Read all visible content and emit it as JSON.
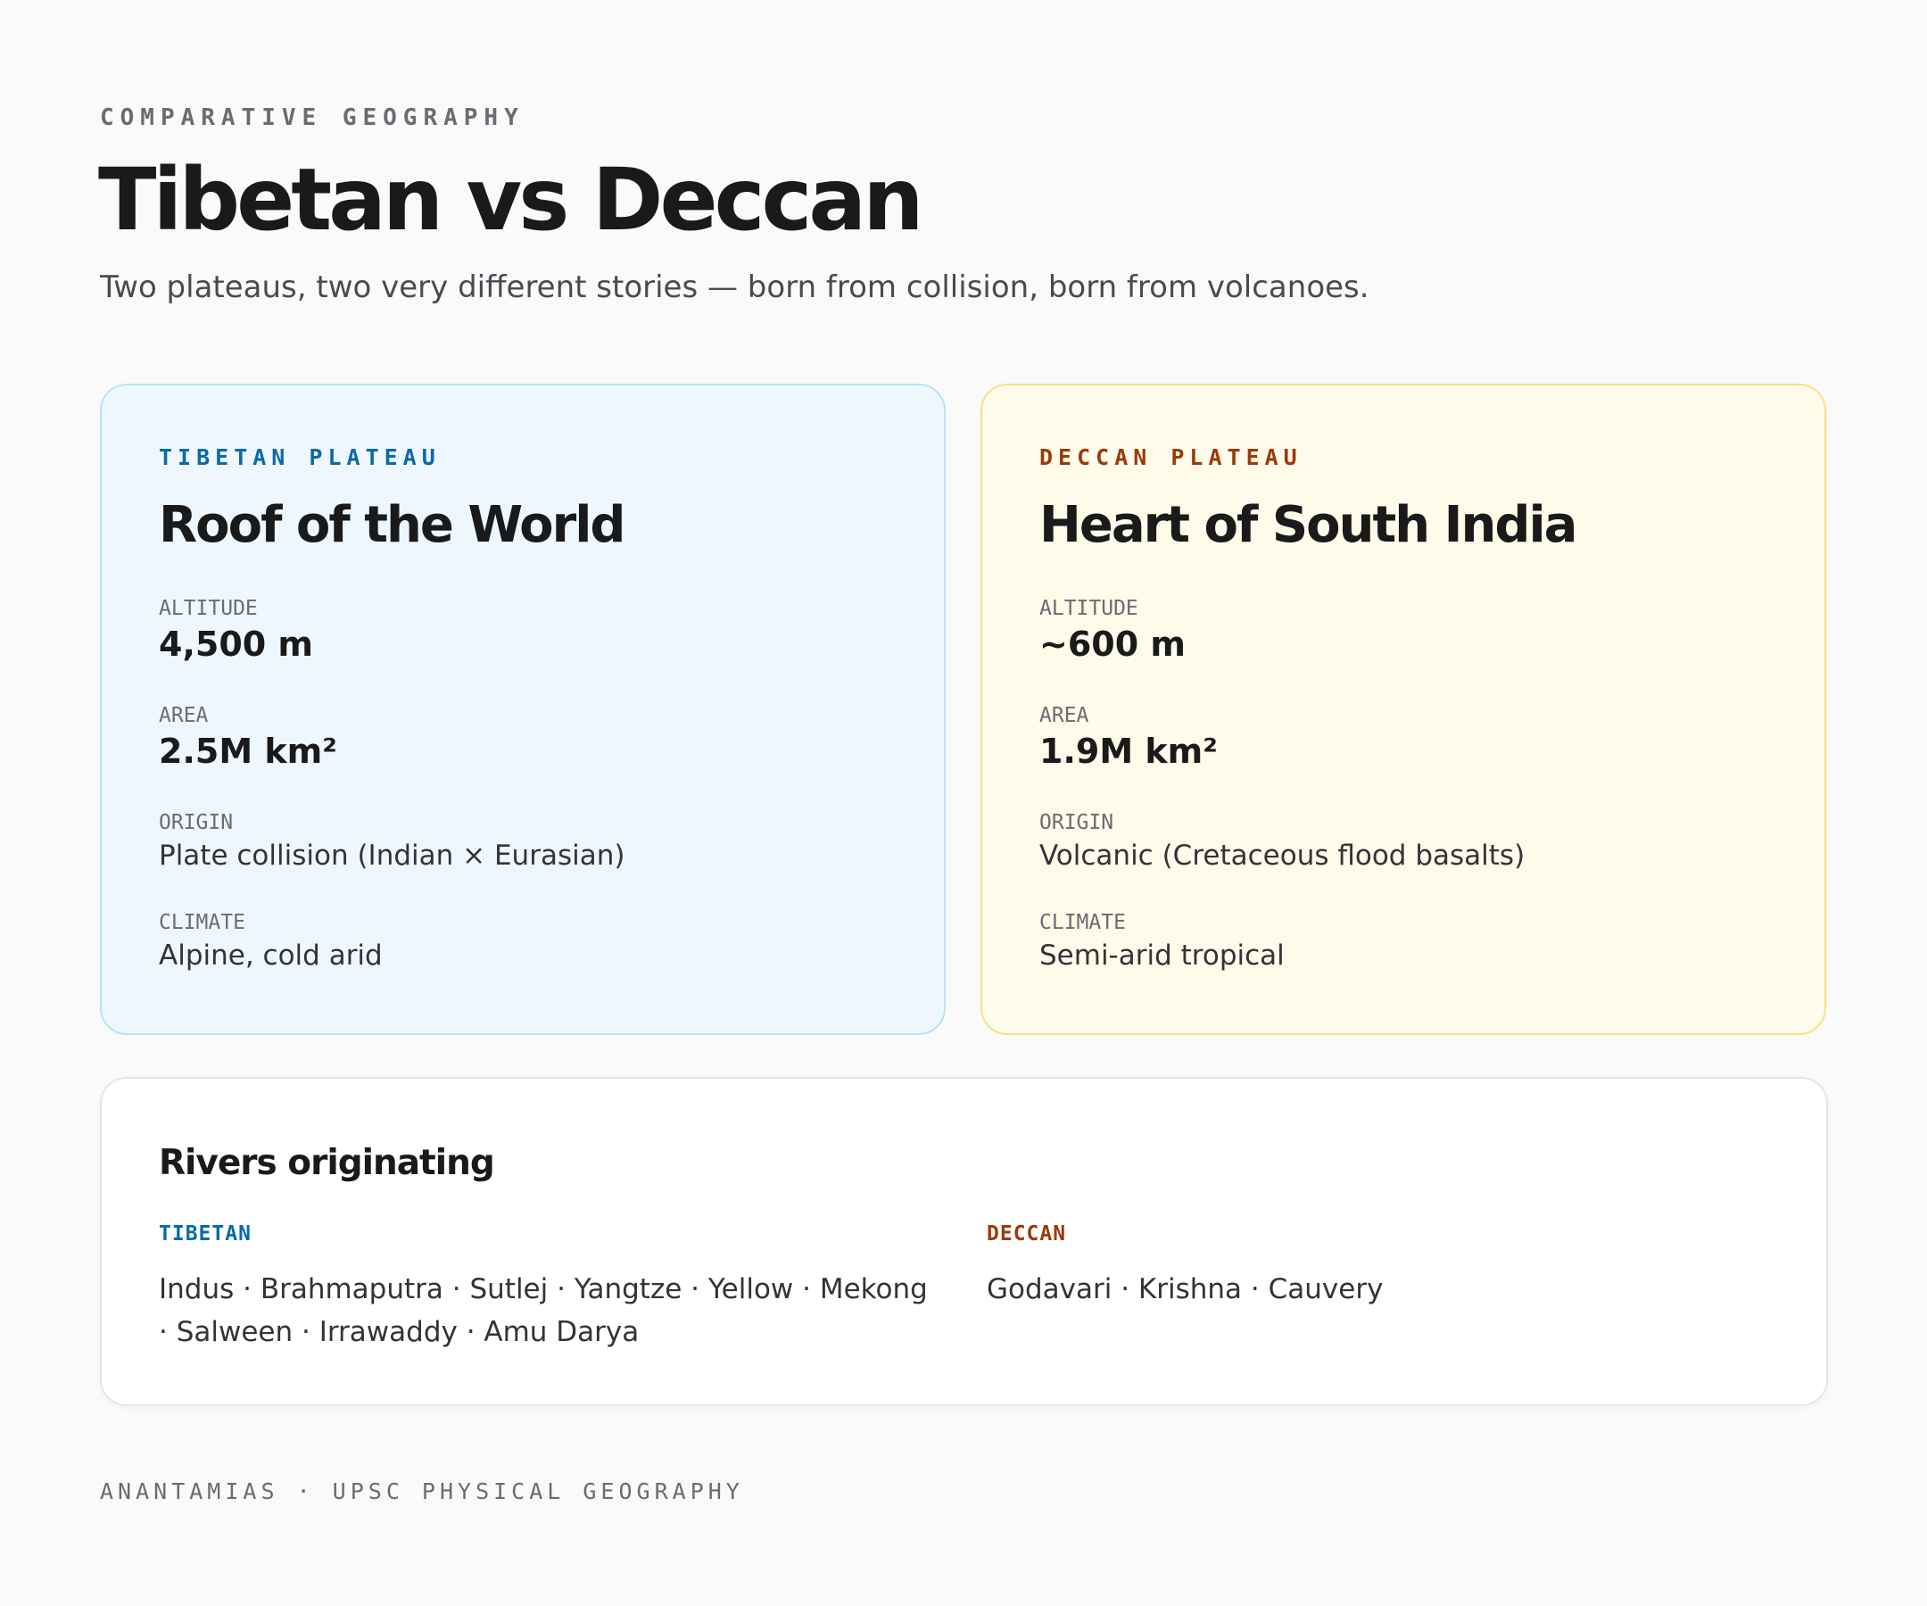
{
  "header": {
    "eyebrow": "COMPARATIVE GEOGRAPHY",
    "title": "Tibetan vs Deccan",
    "subtitle": "Two plateaus, two very different stories — born from collision, born from volcanoes."
  },
  "colors": {
    "tibet_accent": "#0b6aa6",
    "deccan_accent": "#9a3b09",
    "tibet_card_bg": "#eff7fe",
    "tibet_card_border": "#b5e5f5",
    "deccan_card_bg": "#fefbea",
    "deccan_card_border": "#f7e08e"
  },
  "cards": {
    "tibet": {
      "eyebrow": "TIBETAN PLATEAU",
      "heading": "Roof of the World",
      "altitude_label": "ALTITUDE",
      "altitude": "4,500 m",
      "area_label": "AREA",
      "area": "2.5M km²",
      "origin_label": "ORIGIN",
      "origin": "Plate collision (Indian × Eurasian)",
      "climate_label": "CLIMATE",
      "climate": "Alpine, cold arid"
    },
    "deccan": {
      "eyebrow": "DECCAN PLATEAU",
      "heading": "Heart of South India",
      "altitude_label": "ALTITUDE",
      "altitude": "~600 m",
      "area_label": "AREA",
      "area": "1.9M km²",
      "origin_label": "ORIGIN",
      "origin": "Volcanic (Cretaceous flood basalts)",
      "climate_label": "CLIMATE",
      "climate": "Semi-arid tropical"
    }
  },
  "rivers": {
    "heading": "Rivers originating",
    "tibet_label": "TIBETAN",
    "tibet_list": "Indus · Brahmaputra · Sutlej · Yangtze · Yellow · Mekong · Salween · Irrawaddy · Amu Darya",
    "deccan_label": "DECCAN",
    "deccan_list": "Godavari · Krishna · Cauvery"
  },
  "footer": {
    "text": "ANANTAMIAS · UPSC PHYSICAL GEOGRAPHY"
  }
}
